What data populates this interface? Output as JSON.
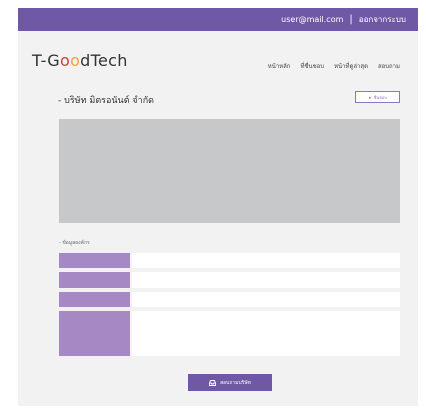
{
  "topbar": {
    "user_email": "user@mail.com",
    "separator": "|",
    "logout": "ออกจากระบบ"
  },
  "logo": {
    "prefix": "T-G",
    "o1": "o",
    "o2": "o",
    "suffix": "dTech"
  },
  "nav": {
    "items": [
      "หน้าหลัก",
      "ที่ชื่นชอบ",
      "หน้าที่ดูล่าสุด",
      "สอบถาม"
    ]
  },
  "company": {
    "name": "- บริษัท มิตรอนันต์ จำกัด"
  },
  "follow_button": {
    "icon": "star-icon",
    "label": "ชื่นชอบ"
  },
  "info_section": {
    "title": "- ข้อมูลองค์กร"
  },
  "contact_button": {
    "icon": "inbox-icon",
    "label": "สอบถามบริษัท"
  },
  "colors": {
    "brand": "#6f59a6",
    "label_fill": "#a588c4",
    "banner_placeholder": "#c6c8c9"
  }
}
